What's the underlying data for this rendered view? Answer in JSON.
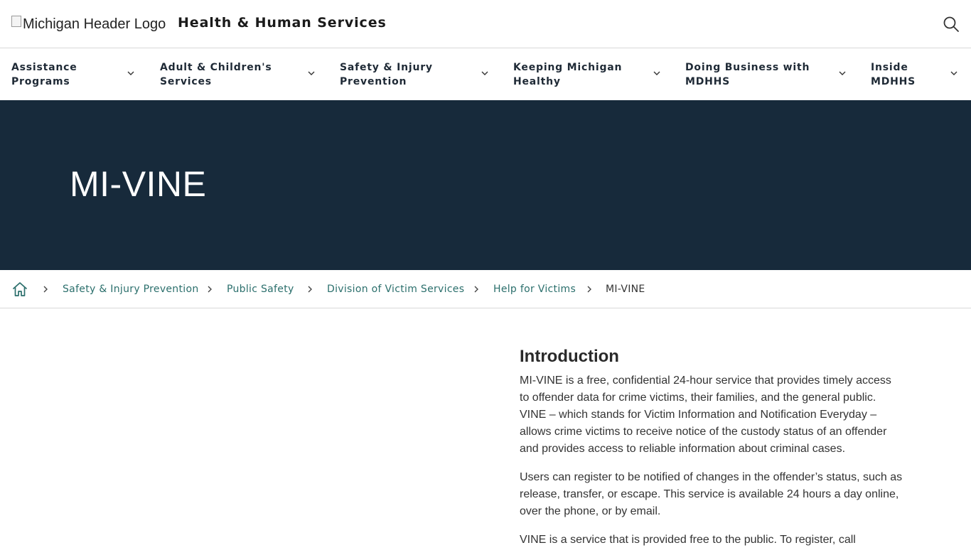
{
  "header": {
    "logo_alt": "Michigan Header Logo",
    "site_title": "Health & Human Services",
    "search_icon": "search-icon"
  },
  "nav": {
    "items": [
      {
        "line1": "Assistance",
        "line2": "Programs"
      },
      {
        "line1": "Adult & Children's",
        "line2": "Services"
      },
      {
        "line1": "Safety & Injury",
        "line2": "Prevention"
      },
      {
        "line1": "Keeping Michigan",
        "line2": "Healthy"
      },
      {
        "line1": "Doing Business with",
        "line2": "MDHHS"
      },
      {
        "line1": "Inside",
        "line2": "MDHHS"
      }
    ],
    "chevron_icon": "chevron-down-icon"
  },
  "hero": {
    "title": "MI-VINE"
  },
  "breadcrumb": {
    "home_icon": "home-icon",
    "separator_icon": "chevron-right-icon",
    "links": [
      "Safety & Injury Prevention",
      "Public Safety",
      "Division of Victim Services",
      "Help for Victims"
    ],
    "current": "MI-VINE"
  },
  "content": {
    "heading": "Introduction",
    "paragraphs": [
      "MI-VINE is a free, confidential 24-hour service that provides timely access to offender data for crime victims, their families, and the general public. VINE – which stands for Victim Information and Notification Everyday – allows crime victims to receive notice of the custody status of an offender and provides access to reliable information about criminal cases.",
      "Users can register to be notified of changes in the offender’s status, such as release, transfer, or escape. This service is available 24 hours a day online, over the phone, or by email.",
      "VINE is a service that is provided free to the public. To register, call"
    ]
  },
  "colors": {
    "hero_background": "#172a3b",
    "link": "#2b6f6c",
    "nav_text": "#1f2a36"
  }
}
